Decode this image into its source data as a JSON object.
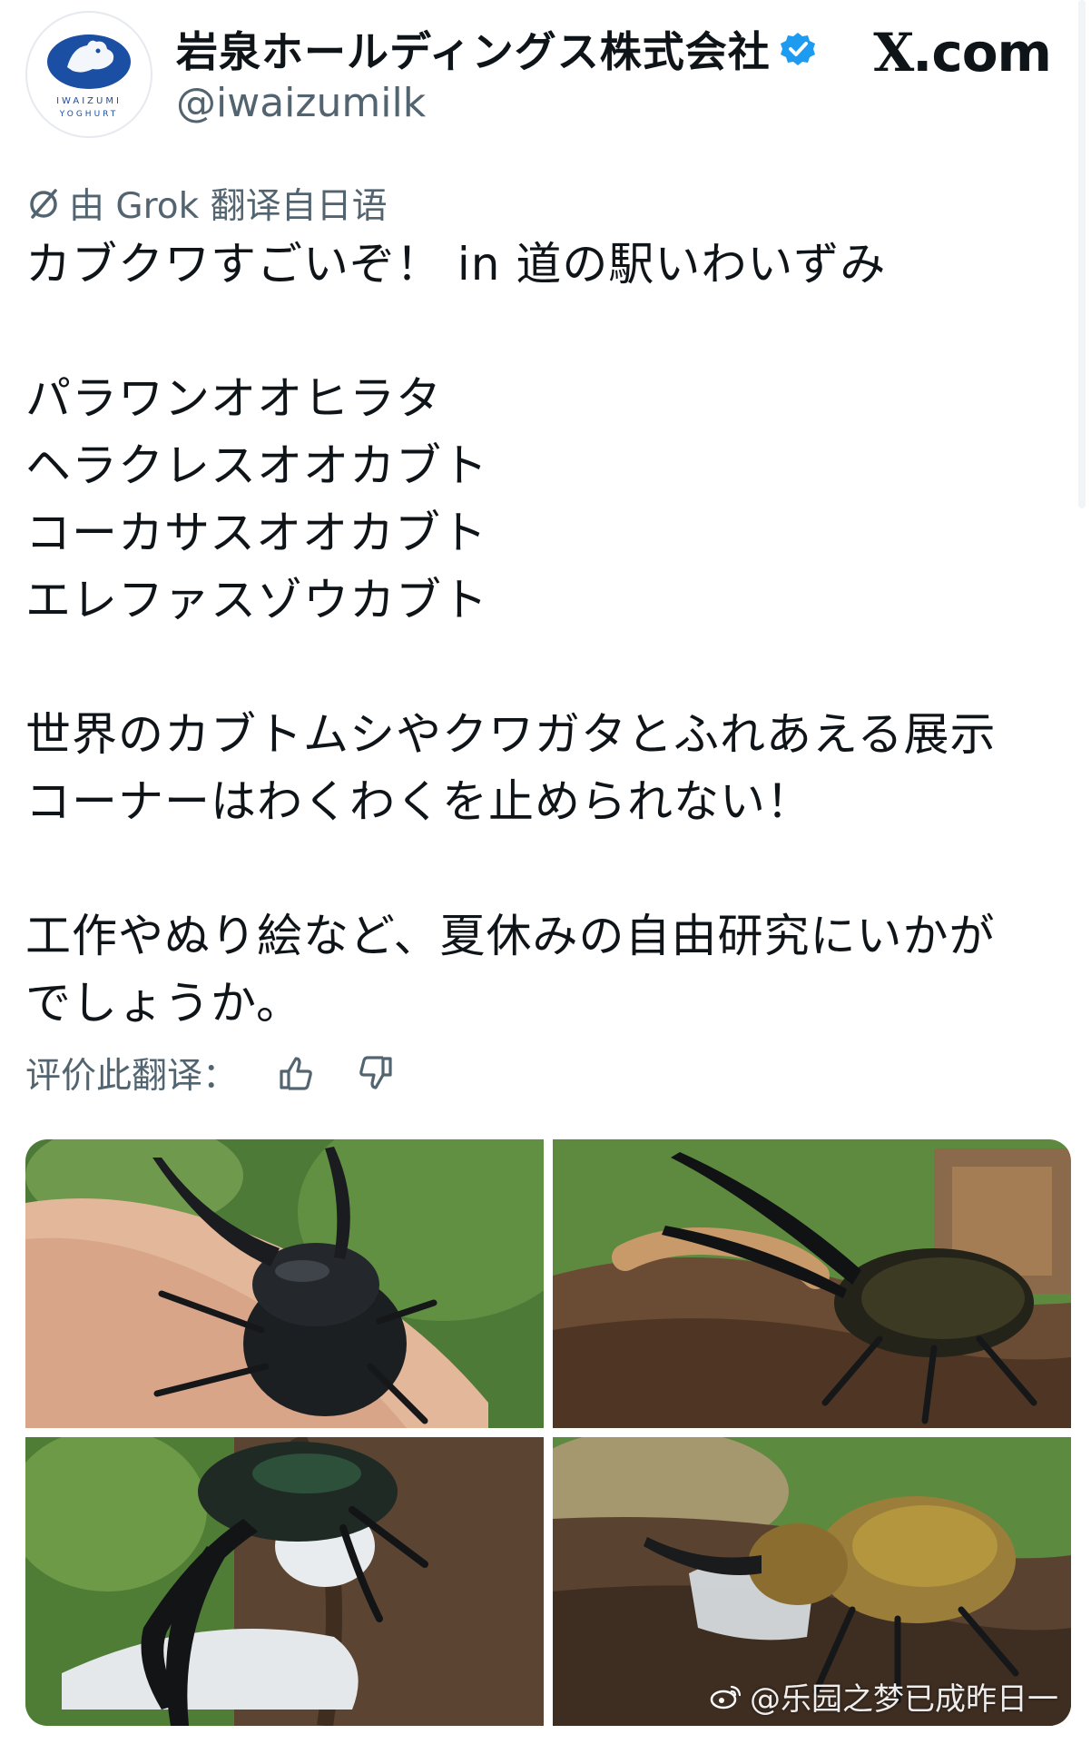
{
  "account": {
    "display_name": "岩泉ホールディングス株式会社",
    "handle": "@iwaizumilk",
    "verified": true,
    "avatar_text_top": "IWAIZUMI",
    "avatar_text_bottom": "YOGHURT"
  },
  "brand": {
    "x_glyph": "X",
    "domain": ".com"
  },
  "translation": {
    "icon": "translate-slash-icon",
    "label": "由 Grok 翻译自日语"
  },
  "tweet": {
    "line1": "カブクワすごいぞ！ in 道の駅いわいずみ",
    "species": [
      "パラワンオオヒラタ",
      "ヘラクレスオオカブト",
      "コーカサスオオカブト",
      "エレファスゾウカブト"
    ],
    "para2_line1": "世界のカブトムシやクワガタとふれあえる展示",
    "para2_line2": "コーナーはわくわくを止められない！",
    "para3_line1": "工作やぬり絵など、夏休みの自由研究にいかが",
    "para3_line2": "でしょうか。"
  },
  "rating": {
    "label": "评价此翻译：",
    "thumbs_up_icon": "thumbs-up-icon",
    "thumbs_down_icon": "thumbs-down-icon"
  },
  "media": {
    "photos": [
      "stag-beetle-on-hand-photo",
      "hercules-beetle-on-log-photo",
      "caucasus-beetle-eating-jelly-photo",
      "elephant-beetle-on-log-photo"
    ]
  },
  "watermark": {
    "text": "@乐园之梦已成昨日一"
  },
  "colors": {
    "text_primary": "#0f1419",
    "text_secondary": "#536471",
    "verified_blue": "#1d9bf0",
    "avatar_blue": "#1a4fa3"
  }
}
